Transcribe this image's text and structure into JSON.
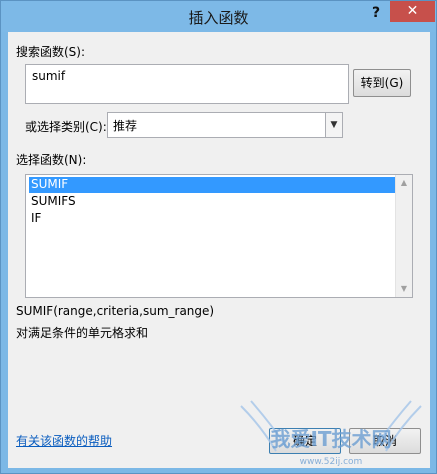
{
  "window": {
    "title": "插入函数",
    "help_label": "?",
    "close_label": "✕"
  },
  "search": {
    "label": "搜索函数(S):",
    "value": "sumif",
    "goto_label": "转到(G)"
  },
  "category": {
    "label": "或选择类别(C):",
    "value": "推荐"
  },
  "function_list": {
    "label": "选择函数(N):",
    "items": [
      "SUMIF",
      "SUMIFS",
      "IF"
    ],
    "selected": "SUMIF"
  },
  "details": {
    "signature": "SUMIF(range,criteria,sum_range)",
    "description": "对满足条件的单元格求和"
  },
  "footer": {
    "help_link": "有关该函数的帮助",
    "ok_label": "确定",
    "cancel_label": "取消"
  },
  "watermark": {
    "text": "我爱IT技术网",
    "url": "www.52ij.com"
  },
  "colors": {
    "titlebar": "#7db9e7",
    "close_button": "#c7504b",
    "selection": "#3399ff",
    "link": "#0a5dbf"
  }
}
